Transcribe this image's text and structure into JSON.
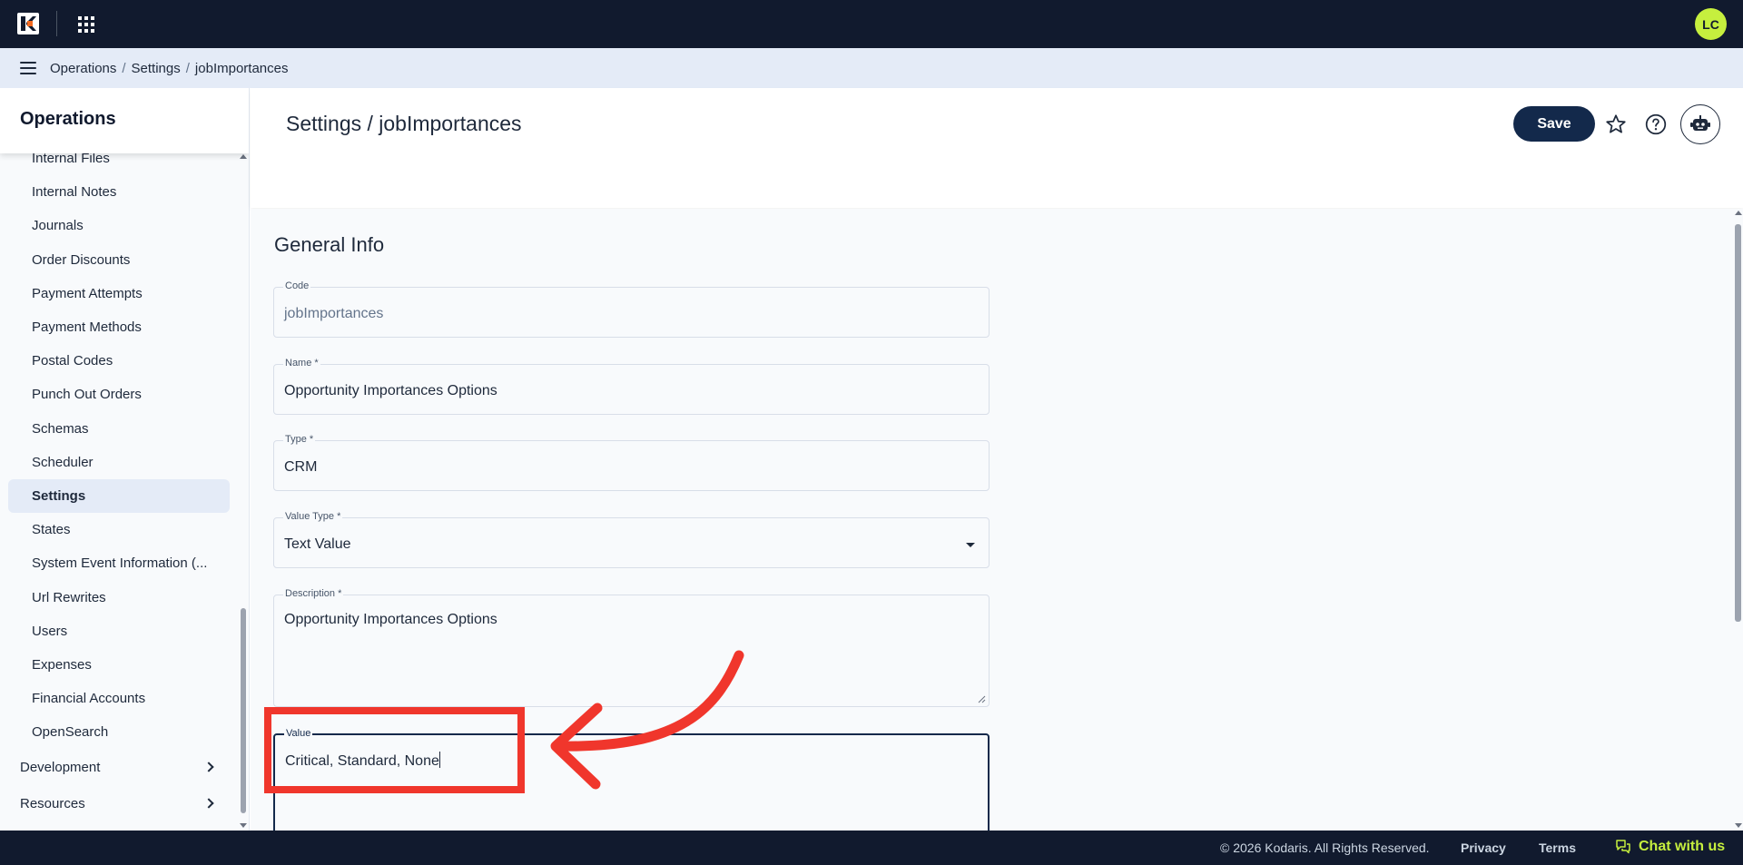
{
  "topbar": {
    "avatar_initials": "LC",
    "brand_color": "#111a2e",
    "avatar_color": "#c6ef3e",
    "logo_accent": "#f26a21"
  },
  "breadcrumb": {
    "items": [
      "Operations",
      "Settings",
      "jobImportances"
    ],
    "separator": "/"
  },
  "sidebar": {
    "title": "Operations",
    "items": [
      {
        "label": "Internal Files"
      },
      {
        "label": "Internal Notes"
      },
      {
        "label": "Journals"
      },
      {
        "label": "Order Discounts"
      },
      {
        "label": "Payment Attempts"
      },
      {
        "label": "Payment Methods"
      },
      {
        "label": "Postal Codes"
      },
      {
        "label": "Punch Out Orders"
      },
      {
        "label": "Schemas"
      },
      {
        "label": "Scheduler"
      },
      {
        "label": "Settings",
        "active": true
      },
      {
        "label": "States"
      },
      {
        "label": "System Event Information (..."
      },
      {
        "label": "Url Rewrites"
      },
      {
        "label": "Users"
      },
      {
        "label": "Expenses"
      },
      {
        "label": "Financial Accounts"
      },
      {
        "label": "OpenSearch"
      }
    ],
    "groups": [
      {
        "label": "Development"
      },
      {
        "label": "Resources"
      }
    ]
  },
  "page": {
    "title": "Settings / jobImportances",
    "save_label": "Save"
  },
  "form": {
    "section_title": "General Info",
    "code": {
      "label": "Code",
      "value": "jobImportances"
    },
    "name": {
      "label": "Name *",
      "value": "Opportunity Importances Options"
    },
    "type": {
      "label": "Type *",
      "value": "CRM"
    },
    "value_type": {
      "label": "Value Type *",
      "value": "Text Value"
    },
    "description": {
      "label": "Description *",
      "value": "Opportunity Importances Options"
    },
    "value": {
      "label": "Value",
      "value": "Critical, Standard, None"
    }
  },
  "annotation": {
    "color": "#f0362c"
  },
  "footer": {
    "copyright": "© 2026 Kodaris. All Rights Reserved.",
    "privacy": "Privacy",
    "terms": "Terms",
    "chat": "Chat with us"
  }
}
